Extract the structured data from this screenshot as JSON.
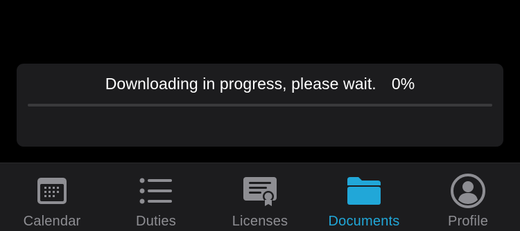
{
  "download": {
    "message": "Downloading in progress, please wait.",
    "percent_label": "0%",
    "progress": 0
  },
  "tabs": [
    {
      "label": "Calendar",
      "icon": "calendar-icon",
      "active": false
    },
    {
      "label": "Duties",
      "icon": "list-icon",
      "active": false
    },
    {
      "label": "Licenses",
      "icon": "certificate-icon",
      "active": false
    },
    {
      "label": "Documents",
      "icon": "folder-icon",
      "active": true
    },
    {
      "label": "Profile",
      "icon": "profile-icon",
      "active": false
    }
  ],
  "colors": {
    "accent": "#21a7d8",
    "inactive": "#8e8e93",
    "card": "#1c1c1e",
    "background": "#000000"
  }
}
